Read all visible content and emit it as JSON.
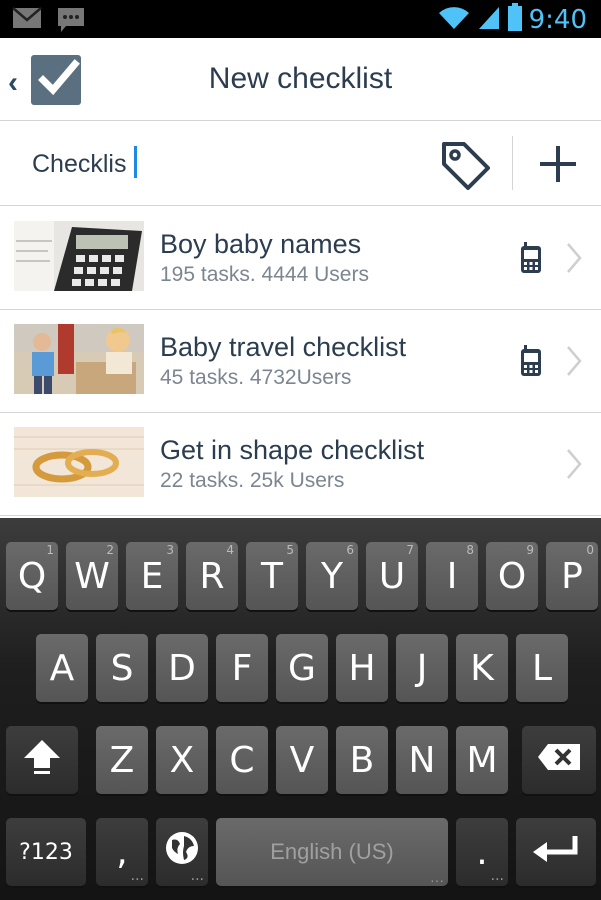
{
  "status_bar": {
    "time": "9:40",
    "left_icons": [
      "gmail-icon",
      "message-icon"
    ],
    "right_icons": [
      "wifi-icon",
      "signal-icon",
      "battery-icon"
    ]
  },
  "app_bar": {
    "title": "New checklist",
    "back_icon": "chevron-left-icon",
    "logo_icon": "checkbox-logo-icon"
  },
  "search": {
    "value": "Checklis",
    "tag_icon": "tag-icon",
    "add_icon": "plus-icon"
  },
  "checklists": [
    {
      "title": "Boy baby names",
      "subtitle": "195 tasks. 4444 Users",
      "thumb": "calculator-photo",
      "device_icon": true
    },
    {
      "title": "Baby travel checklist",
      "subtitle": "45 tasks. 4732Users",
      "thumb": "kids-moving-photo",
      "device_icon": true
    },
    {
      "title": "Get in shape checklist",
      "subtitle": "22 tasks. 25k Users",
      "thumb": "wedding-rings-photo",
      "device_icon": false
    }
  ],
  "keyboard": {
    "row1": [
      {
        "k": "Q",
        "h": "1"
      },
      {
        "k": "W",
        "h": "2"
      },
      {
        "k": "E",
        "h": "3"
      },
      {
        "k": "R",
        "h": "4"
      },
      {
        "k": "T",
        "h": "5"
      },
      {
        "k": "Y",
        "h": "6"
      },
      {
        "k": "U",
        "h": "7"
      },
      {
        "k": "I",
        "h": "8"
      },
      {
        "k": "O",
        "h": "9"
      },
      {
        "k": "P",
        "h": "0"
      }
    ],
    "row2": [
      "A",
      "S",
      "D",
      "F",
      "G",
      "H",
      "J",
      "K",
      "L"
    ],
    "row3": [
      "Z",
      "X",
      "C",
      "V",
      "B",
      "N",
      "M"
    ],
    "symbols_label": "?123",
    "comma_label": ",",
    "space_label": "English (US)",
    "period_label": ".",
    "shift_icon": "shift-icon",
    "backspace_icon": "backspace-icon",
    "globe_icon": "globe-icon",
    "enter_icon": "enter-icon"
  },
  "colors": {
    "accent": "#4fc3f7",
    "title_text": "#2b3d4f",
    "subtitle_text": "#7c8690",
    "caret": "#1e88e5"
  }
}
